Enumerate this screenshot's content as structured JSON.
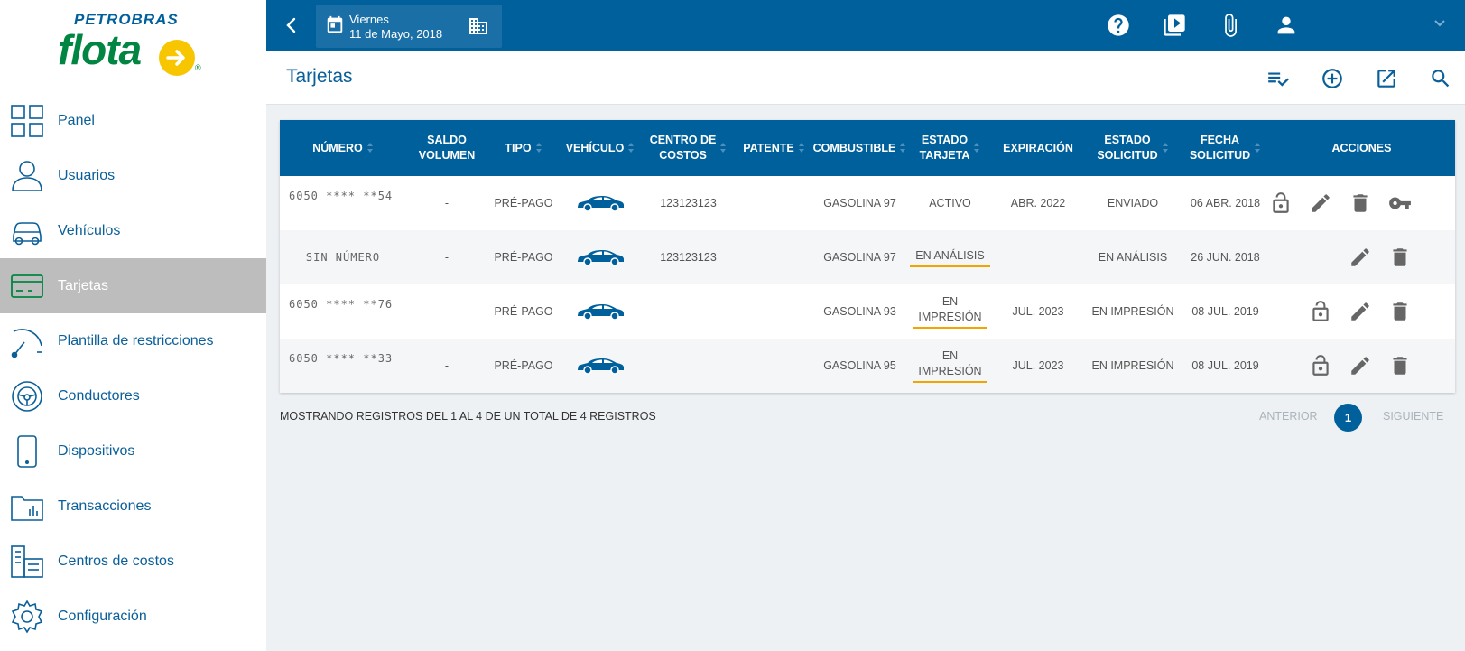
{
  "logo": {
    "brand": "PETROBRAS",
    "product": "flota",
    "reg": "®"
  },
  "sidebar": {
    "items": [
      {
        "label": "Panel",
        "icon": "grid-icon"
      },
      {
        "label": "Usuarios",
        "icon": "user-icon"
      },
      {
        "label": "Vehículos",
        "icon": "car-icon"
      },
      {
        "label": "Tarjetas",
        "icon": "card-icon",
        "active": true
      },
      {
        "label": "Plantilla de restricciones",
        "icon": "gauge-icon"
      },
      {
        "label": "Conductores",
        "icon": "steering-wheel-icon"
      },
      {
        "label": "Dispositivos",
        "icon": "phone-icon"
      },
      {
        "label": "Transacciones",
        "icon": "chart-folder-icon"
      },
      {
        "label": "Centros de costos",
        "icon": "buildings-icon"
      },
      {
        "label": "Configuración",
        "icon": "gear-icon"
      }
    ]
  },
  "topbar": {
    "day": "Viernes",
    "date": "11 de Mayo, 2018"
  },
  "titlebar": {
    "title": "Tarjetas"
  },
  "table": {
    "headers": {
      "numero": "NÚMERO",
      "saldo1": "SALDO",
      "saldo2": "VOLUMEN",
      "tipo": "TIPO",
      "vehiculo": "VEHÍCULO",
      "centro1": "CENTRO DE",
      "centro2": "COSTOS",
      "patente": "PATENTE",
      "combustible": "COMBUSTIBLE",
      "estado1": "ESTADO",
      "estado2": "TARJETA",
      "expiracion": "EXPIRACIÓN",
      "solicitud1": "ESTADO",
      "solicitud2": "SOLICITUD",
      "fecha1": "FECHA",
      "fecha2": "SOLICITUD",
      "acciones": "ACCIONES"
    },
    "rows": [
      {
        "numero": "6050 **** **54",
        "saldo": "-",
        "tipo": "PRÉ-PAGO",
        "centro": "123123123",
        "patente": "",
        "combustible": "GASOLINA 97",
        "estado": "ACTIVO",
        "estado2": "",
        "expiracion": "ABR. 2022",
        "solicitud": "ENVIADO",
        "fecha": "06 ABR. 2018"
      },
      {
        "numero": "SIN NÚMERO",
        "saldo": "-",
        "tipo": "PRÉ-PAGO",
        "centro": "123123123",
        "patente": "",
        "combustible": "GASOLINA 97",
        "estado": "EN ANÁLISIS",
        "estado2": "",
        "expiracion": "",
        "solicitud": "EN ANÁLISIS",
        "fecha": "26 JUN. 2018"
      },
      {
        "numero": "6050 **** **76",
        "saldo": "-",
        "tipo": "PRÉ-PAGO",
        "centro": "",
        "patente": "",
        "combustible": "GASOLINA 93",
        "estado": "EN",
        "estado2": "IMPRESIÓN",
        "expiracion": "JUL. 2023",
        "solicitud": "EN IMPRESIÓN",
        "fecha": "08 JUL. 2019"
      },
      {
        "numero": "6050 **** **33",
        "saldo": "-",
        "tipo": "PRÉ-PAGO",
        "centro": "",
        "patente": "",
        "combustible": "GASOLINA 95",
        "estado": "EN",
        "estado2": "IMPRESIÓN",
        "expiracion": "JUL. 2023",
        "solicitud": "EN IMPRESIÓN",
        "fecha": "08 JUL. 2019"
      }
    ]
  },
  "footer": {
    "summary": "MOSTRANDO REGISTROS DEL 1 AL 4 DE UN TOTAL DE 4 REGISTROS",
    "prev": "ANTERIOR",
    "page": "1",
    "next": "SIGUIENTE"
  },
  "colors": {
    "primary": "#00609c",
    "accent": "#f0a500",
    "active_bg": "#bdbdbd",
    "brand_green": "#008542"
  }
}
